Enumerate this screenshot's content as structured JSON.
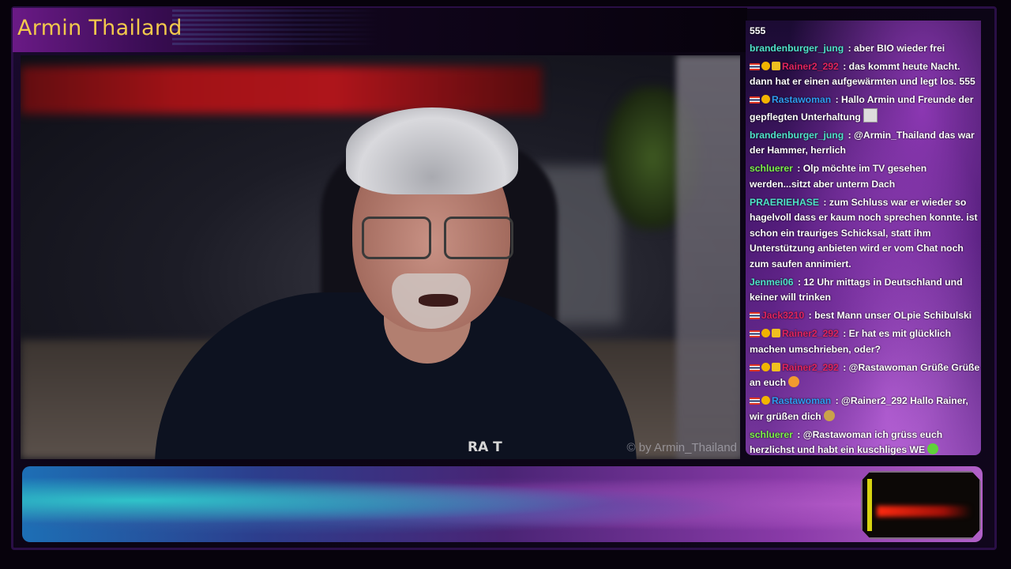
{
  "stream": {
    "title": "Armin Thailand",
    "watermark": "© by Armin_Thailand",
    "shirt_text": "RA  T"
  },
  "colors": {
    "title": "#f2c94c",
    "chat_background": "#3a1262",
    "banner_accent": "#2fc3c9"
  },
  "chat": {
    "top_fragment": "555",
    "messages": [
      {
        "badges": [],
        "user": "brandenburger_jung",
        "color": "#4fe3c9",
        "text": " : aber BIO wieder frei"
      },
      {
        "badges": [
          "flag-icon",
          "coin-badge-icon",
          "crown-badge-icon"
        ],
        "user": "Rainer2_292",
        "color": "#e0245e",
        "text": " : das kommt heute Nacht. dann hat er einen aufgewärmten und legt los. 555"
      },
      {
        "badges": [
          "flag-icon",
          "coin-badge-icon"
        ],
        "user": "Rastawoman",
        "color": "#2e9cf0",
        "text": " : Hallo Armin und Freunde der gepflegten Unterhaltung",
        "emote": "image-emote"
      },
      {
        "badges": [],
        "user": "brandenburger_jung",
        "color": "#4fe3c9",
        "text": " : @Armin_Thailand das war der Hammer, herrlich"
      },
      {
        "badges": [],
        "user": "schluerer",
        "color": "#7cf24a",
        "text": " : Olp möchte im TV gesehen werden...sitzt aber unterm Dach"
      },
      {
        "badges": [],
        "user": "PRAERIEHASE",
        "color": "#4fe3c9",
        "text": " : zum Schluss war er wieder so hagelvoll dass er kaum noch sprechen konnte. ist schon ein trauriges Schicksal, statt ihm Unterstützung anbieten wird er vom Chat noch zum saufen annimiert."
      },
      {
        "badges": [],
        "user": "Jenmei06",
        "color": "#4fe3c9",
        "text": " : 12 Uhr mittags in Deutschland und keiner will trinken"
      },
      {
        "badges": [
          "flag-icon"
        ],
        "user": "Jack3210",
        "color": "#e0245e",
        "text": " : best Mann unser OLpie Schibulski"
      },
      {
        "badges": [
          "flag-icon",
          "coin-badge-icon",
          "crown-badge-icon"
        ],
        "user": "Rainer2_292",
        "color": "#e0245e",
        "text": " : Er hat es mit glücklich machen umschrieben, oder?"
      },
      {
        "badges": [
          "flag-icon",
          "coin-badge-icon",
          "crown-badge-icon"
        ],
        "user": "Rainer2_292",
        "color": "#e0245e",
        "text": " : @Rastawoman Grüße Grüße an euch",
        "emote": "smile-emote"
      },
      {
        "badges": [
          "flag-icon",
          "coin-badge-icon"
        ],
        "user": "Rastawoman",
        "color": "#2e9cf0",
        "text": " : @Rainer2_292 Hallo Rainer, wir grüßen dich",
        "emote": "wave-emote"
      },
      {
        "badges": [],
        "user": "schluerer",
        "color": "#7cf24a",
        "text": " : @Rastawoman ich grüss euch herzlichst und habt ein kuschliges WE",
        "emote": "green-emote"
      }
    ]
  }
}
